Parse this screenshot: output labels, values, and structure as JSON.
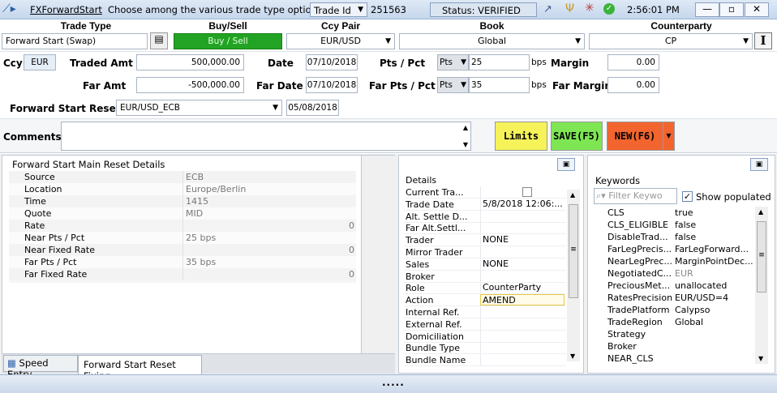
{
  "titlebar": {
    "link": "FXForwardStart",
    "hint": "Choose among the various trade type options",
    "trade_id_label": "Trade Id",
    "trade_id": "251563",
    "status": "Status: VERIFIED",
    "clock": "2:56:01 PM"
  },
  "headers": {
    "trade_type": "Trade Type",
    "buy_sell": "Buy/Sell",
    "ccy_pair": "Ccy Pair",
    "book": "Book",
    "counterparty": "Counterparty"
  },
  "row1": {
    "trade_type": "Forward Start (Swap)",
    "buy_sell": "Buy / Sell",
    "ccy_pair": "EUR/USD",
    "book": "Global",
    "counterparty": "CP",
    "side_btn": "I"
  },
  "row2": {
    "ccy_label": "Ccy",
    "ccy_value": "EUR",
    "traded_amt_label": "Traded Amt",
    "traded_amt": "500,000.00",
    "date_label": "Date",
    "date": "07/10/2018",
    "pts_label": "Pts / Pct",
    "pts_mode": "Pts",
    "pts_value": "25",
    "pts_unit": "bps",
    "margin_label": "Margin",
    "margin": "0.00"
  },
  "row3": {
    "far_amt_label": "Far Amt",
    "far_amt": "-500,000.00",
    "far_date_label": "Far Date",
    "far_date": "07/10/2018",
    "far_pts_label": "Far Pts / Pct",
    "far_pts_mode": "Pts",
    "far_pts_value": "35",
    "far_pts_unit": "bps",
    "far_margin_label": "Far Margin",
    "far_margin": "0.00"
  },
  "row4": {
    "reset_label": "Forward Start Reset",
    "reset_value": "EUR/USD_ECB",
    "reset_date": "05/08/2018"
  },
  "row5": {
    "comments_label": "Comments",
    "limits": "Limits",
    "save": "SAVE(F5)",
    "new": "NEW(F6)"
  },
  "reset_details": {
    "title": "Forward Start Main Reset Details",
    "rows": [
      {
        "k": "Source",
        "v": "ECB",
        "n": ""
      },
      {
        "k": "Location",
        "v": "Europe/Berlin",
        "n": ""
      },
      {
        "k": "Time",
        "v": "1415",
        "n": ""
      },
      {
        "k": "Quote",
        "v": "MID",
        "n": ""
      },
      {
        "k": "Rate",
        "v": "",
        "n": "0"
      },
      {
        "k": "Near Pts / Pct",
        "v": "25 bps",
        "n": ""
      },
      {
        "k": "Near Fixed Rate",
        "v": "",
        "n": "0"
      },
      {
        "k": "Far Pts / Pct",
        "v": "35 bps",
        "n": ""
      },
      {
        "k": "Far Fixed Rate",
        "v": "",
        "n": "0"
      }
    ],
    "tabs": [
      "Speed Entry",
      "Forward Start Reset Fixing"
    ]
  },
  "details": {
    "title": "Details",
    "rows": [
      {
        "k": "Current Tra...",
        "v": ""
      },
      {
        "k": "Trade Date",
        "v": "5/8/2018 12:06:..."
      },
      {
        "k": "Alt. Settle D...",
        "v": ""
      },
      {
        "k": "Far Alt.Settl...",
        "v": ""
      },
      {
        "k": "Trader",
        "v": "NONE"
      },
      {
        "k": "Mirror Trader",
        "v": ""
      },
      {
        "k": "Sales",
        "v": "NONE"
      },
      {
        "k": "Broker",
        "v": ""
      },
      {
        "k": "Role",
        "v": "CounterParty"
      },
      {
        "k": "Action",
        "v": "AMEND"
      },
      {
        "k": "Internal Ref.",
        "v": ""
      },
      {
        "k": "External Ref.",
        "v": ""
      },
      {
        "k": "Domiciliation",
        "v": ""
      },
      {
        "k": "Bundle Type",
        "v": ""
      },
      {
        "k": "Bundle Name",
        "v": ""
      }
    ]
  },
  "keywords": {
    "title": "Keywords",
    "filter_placeholder": "Filter Keywo",
    "show_populated": "Show populated",
    "rows": [
      {
        "k": "CLS",
        "v": "true"
      },
      {
        "k": "CLS_ELIGIBLE",
        "v": "false"
      },
      {
        "k": "DisableTrad...",
        "v": "false"
      },
      {
        "k": "FarLegPrecis...",
        "v": "FarLegForward..."
      },
      {
        "k": "NearLegPrec...",
        "v": "MarginPointDec..."
      },
      {
        "k": "NegotiatedC...",
        "v": "EUR"
      },
      {
        "k": "PreciousMet...",
        "v": "unallocated"
      },
      {
        "k": "RatesPrecision",
        "v": "EUR/USD=4"
      },
      {
        "k": "TradePlatform",
        "v": "Calypso"
      },
      {
        "k": "TradeRegion",
        "v": "Global"
      },
      {
        "k": "Strategy",
        "v": ""
      },
      {
        "k": "Broker",
        "v": ""
      },
      {
        "k": "NEAR_CLS",
        "v": ""
      }
    ]
  },
  "footer": {
    "grip": "....."
  },
  "colors": {
    "buysell": "#23a323",
    "limits": "#f5f25a",
    "save": "#7ee653",
    "new": "#f2652f"
  }
}
